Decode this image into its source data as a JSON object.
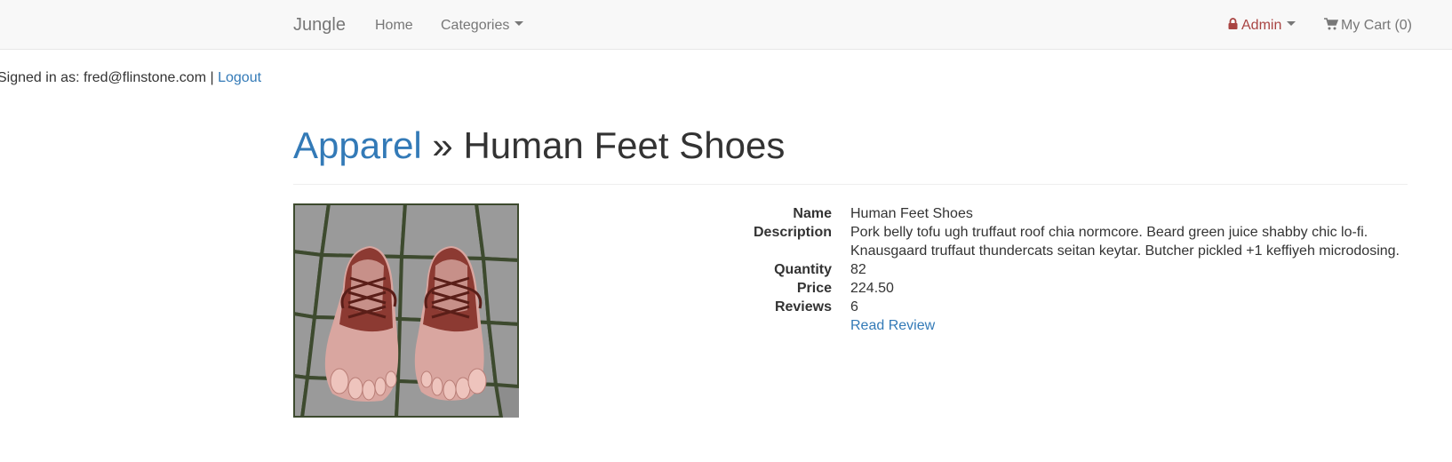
{
  "navbar": {
    "brand": "Jungle",
    "home": "Home",
    "categories": "Categories",
    "admin": "Admin",
    "cart": "My Cart (0)"
  },
  "session": {
    "signed_in_text": "Signed in as: fred@flinstone.com |",
    "logout": "Logout"
  },
  "breadcrumb": {
    "category": "Apparel",
    "separator": " » ",
    "product": "Human Feet Shoes"
  },
  "product": {
    "image_alt": "Human Feet Shoes",
    "fields": {
      "name_label": "Name",
      "name": "Human Feet Shoes",
      "description_label": "Description",
      "description": "Pork belly tofu ugh truffaut roof chia normcore. Beard green juice shabby chic lo-fi. Knausgaard truffaut thundercats seitan keytar. Butcher pickled +1 keffiyeh microdosing.",
      "quantity_label": "Quantity",
      "quantity": "82",
      "price_label": "Price",
      "price": "224.50",
      "reviews_label": "Reviews",
      "reviews": "6",
      "read_review": "Read Review"
    }
  },
  "colors": {
    "link": "#337ab7",
    "admin": "#a94442",
    "navbar_bg": "#f8f8f8"
  },
  "icons": {
    "admin": "lock-icon",
    "cart": "shopping-cart-icon",
    "dropdown": "caret-down-icon"
  }
}
